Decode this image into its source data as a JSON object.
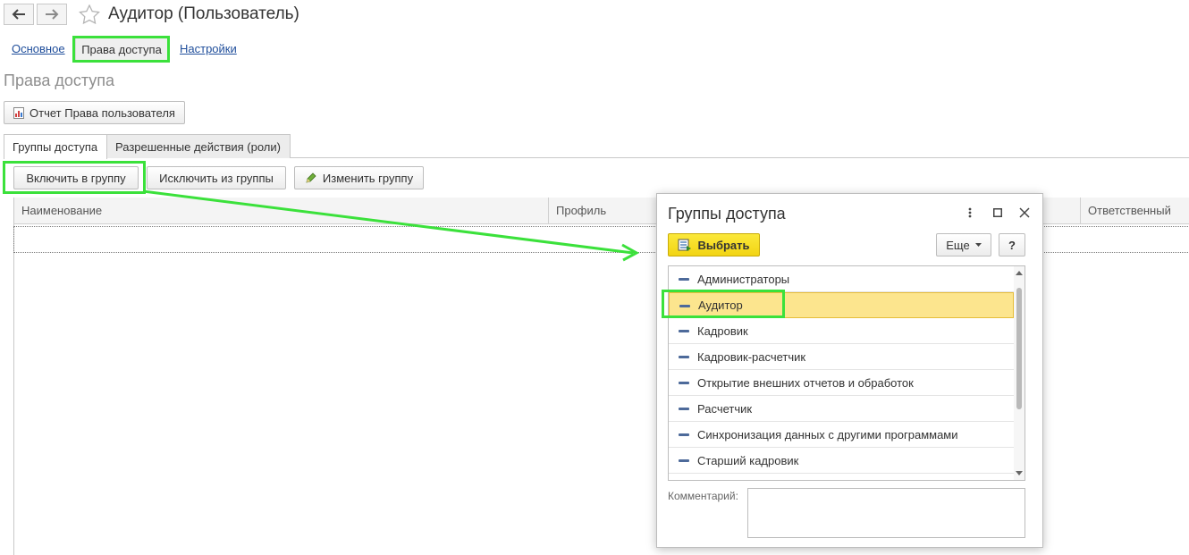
{
  "window": {
    "title": "Аудитор (Пользователь)"
  },
  "sections": {
    "main": "Основное",
    "access_rights": "Права доступа",
    "settings": "Настройки"
  },
  "page": {
    "title": "Права доступа",
    "report_button": "Отчет Права пользователя"
  },
  "tabs": {
    "groups": "Группы доступа",
    "roles": "Разрешенные действия (роли)"
  },
  "toolbar": {
    "include": "Включить в группу",
    "exclude": "Исключить из группы",
    "change": "Изменить группу"
  },
  "table": {
    "columns": [
      "Наименование",
      "Профиль",
      "Ответственный"
    ]
  },
  "dialog": {
    "title": "Группы доступа",
    "select_button": "Выбрать",
    "more_button": "Еще",
    "help_button": "?",
    "items": [
      "Администраторы",
      "Аудитор",
      "Кадровик",
      "Кадровик-расчетчик",
      "Открытие внешних отчетов и обработок",
      "Расчетчик",
      "Синхронизация данных с другими программами",
      "Старший кадровик"
    ],
    "selected_index": 1,
    "comment_label": "Комментарий:",
    "comment_value": ""
  },
  "colors": {
    "highlight": "#3be13b",
    "selected_row": "#fce58e",
    "primary_button": "#f2d414",
    "link": "#1f4e9b"
  },
  "icons": {
    "back": "arrow-left-icon",
    "forward": "arrow-right-icon",
    "favorite": "star-icon",
    "report": "report-icon",
    "edit": "pencil-icon",
    "select": "select-list-icon",
    "menu": "vertical-dots-icon",
    "maximize": "maximize-icon",
    "close": "close-icon",
    "item": "group-icon"
  }
}
